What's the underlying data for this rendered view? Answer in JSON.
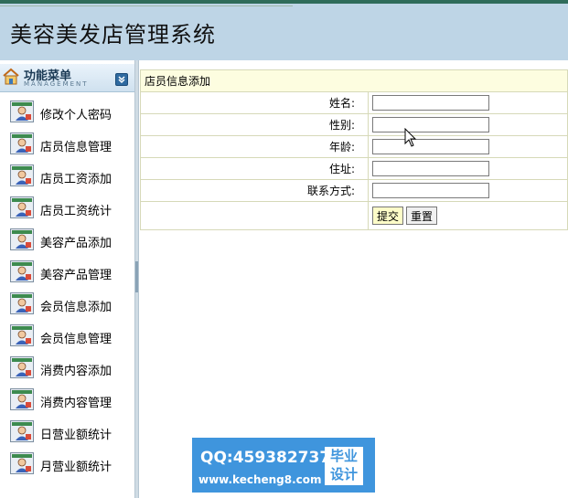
{
  "app": {
    "title": "美容美发店管理系统"
  },
  "sidebar": {
    "title": "功能菜单",
    "subtitle": "MANAGEMENT",
    "items": [
      {
        "label": "修改个人密码"
      },
      {
        "label": "店员信息管理"
      },
      {
        "label": "店员工资添加"
      },
      {
        "label": "店员工资统计"
      },
      {
        "label": "美容产品添加"
      },
      {
        "label": "美容产品管理"
      },
      {
        "label": "会员信息添加"
      },
      {
        "label": "会员信息管理"
      },
      {
        "label": "消费内容添加"
      },
      {
        "label": "消费内容管理"
      },
      {
        "label": "日营业额统计"
      },
      {
        "label": "月营业额统计"
      }
    ]
  },
  "form": {
    "title": "店员信息添加",
    "fields": [
      {
        "label": "姓名:",
        "value": ""
      },
      {
        "label": "性别:",
        "value": ""
      },
      {
        "label": "年龄:",
        "value": ""
      },
      {
        "label": "住址:",
        "value": ""
      },
      {
        "label": "联系方式:",
        "value": ""
      }
    ],
    "submit_label": "提交",
    "reset_label": "重置"
  },
  "watermark": {
    "qq": "QQ:459382737",
    "url": "www.kecheng8.com",
    "badge_line1": "毕业",
    "badge_line2": "设计"
  },
  "colors": {
    "header_bg": "#bed5e6",
    "form_header_bg": "#fdfde0",
    "watermark_bg": "#3f95dd"
  }
}
